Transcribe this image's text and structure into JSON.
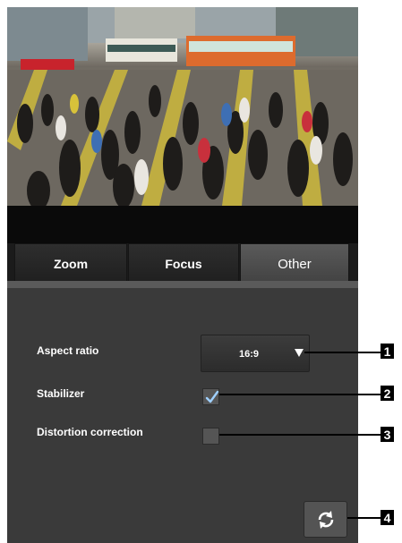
{
  "tabs": [
    {
      "label": "Zoom",
      "active": false
    },
    {
      "label": "Focus",
      "active": false
    },
    {
      "label": "Other",
      "active": true
    }
  ],
  "settings": {
    "aspect_ratio": {
      "label": "Aspect ratio",
      "value": "16:9"
    },
    "stabilizer": {
      "label": "Stabilizer",
      "checked": true
    },
    "distortion_correction": {
      "label": "Distortion correction",
      "checked": false
    }
  },
  "icons": {
    "dropdown": "triangle-down-icon",
    "stabilizer_check": "check-icon",
    "refresh": "refresh-icon"
  },
  "callouts": [
    "1",
    "2",
    "3",
    "4"
  ],
  "colors": {
    "panel_bg": "#3a3a3a",
    "tab_active": "#4e4e4e",
    "tab_inactive": "#262626",
    "check_color": "#9fd0ff"
  }
}
